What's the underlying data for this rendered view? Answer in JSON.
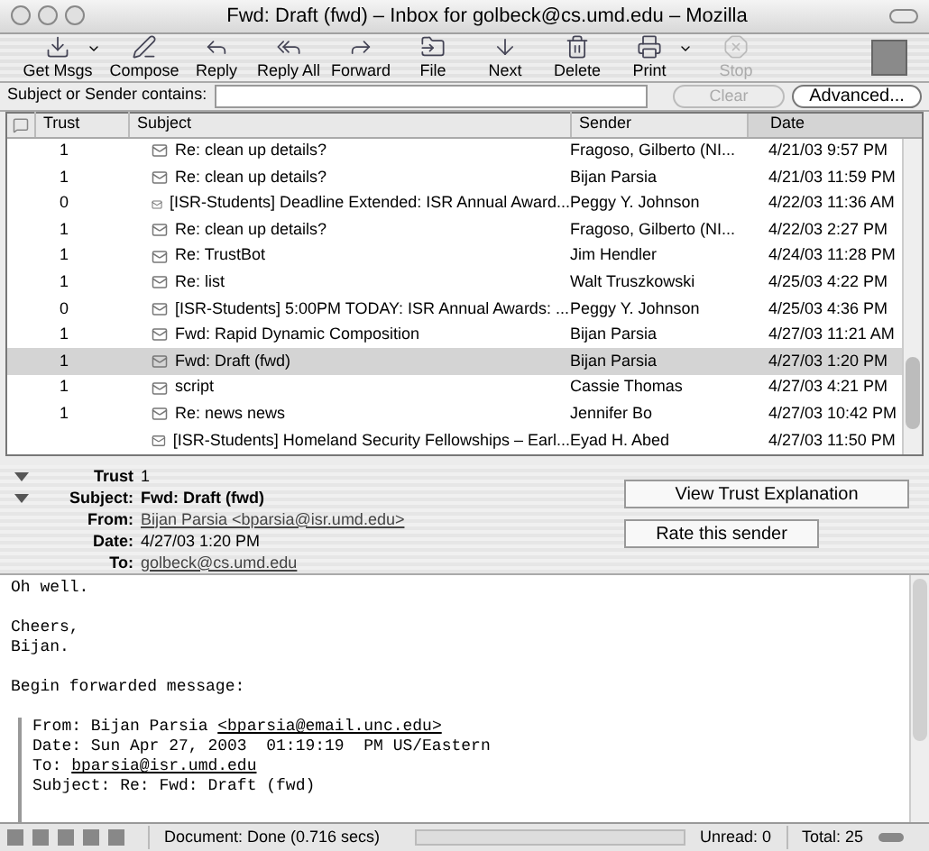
{
  "window": {
    "title": "Fwd: Draft (fwd) – Inbox for golbeck@cs.umd.edu – Mozilla"
  },
  "toolbar": [
    {
      "label": "Get Msgs",
      "kind": "getmsgs",
      "dropdown": true,
      "disabled": false
    },
    {
      "label": "Compose",
      "kind": "compose",
      "dropdown": false,
      "disabled": false
    },
    {
      "label": "Reply",
      "kind": "reply",
      "dropdown": false,
      "disabled": false
    },
    {
      "label": "Reply All",
      "kind": "replyall",
      "dropdown": false,
      "disabled": false
    },
    {
      "label": "Forward",
      "kind": "forward",
      "dropdown": false,
      "disabled": false
    },
    {
      "label": "File",
      "kind": "file",
      "dropdown": false,
      "disabled": false
    },
    {
      "label": "Next",
      "kind": "next",
      "dropdown": false,
      "disabled": false
    },
    {
      "label": "Delete",
      "kind": "delete",
      "dropdown": false,
      "disabled": false
    },
    {
      "label": "Print",
      "kind": "print",
      "dropdown": true,
      "disabled": false
    },
    {
      "label": "Stop",
      "kind": "stop",
      "dropdown": false,
      "disabled": true
    }
  ],
  "search": {
    "label": "Subject or Sender contains:",
    "clear": "Clear",
    "advanced": "Advanced..."
  },
  "table": {
    "columns": [
      "Trust",
      "Subject",
      "Sender",
      "Date"
    ],
    "rows": [
      {
        "trust": "1",
        "subject": "Re: clean up details?",
        "sender": "Fragoso, Gilberto (NI...",
        "date": "4/21/03 9:57 PM",
        "selected": false
      },
      {
        "trust": "1",
        "subject": "Re: clean up details?",
        "sender": "Bijan Parsia",
        "date": "4/21/03 11:59 PM",
        "selected": false
      },
      {
        "trust": "0",
        "subject": "[ISR-Students] Deadline Extended: ISR Annual Award...",
        "sender": "Peggy Y. Johnson",
        "date": "4/22/03 11:36 AM",
        "selected": false
      },
      {
        "trust": "1",
        "subject": "Re: clean up details?",
        "sender": "Fragoso, Gilberto (NI...",
        "date": "4/22/03 2:27 PM",
        "selected": false
      },
      {
        "trust": "1",
        "subject": "Re: TrustBot",
        "sender": "Jim Hendler",
        "date": "4/24/03 11:28 PM",
        "selected": false
      },
      {
        "trust": "1",
        "subject": "Re: list",
        "sender": "Walt Truszkowski",
        "date": "4/25/03 4:22 PM",
        "selected": false
      },
      {
        "trust": "0",
        "subject": "[ISR-Students] 5:00PM TODAY: ISR Annual Awards: ...",
        "sender": "Peggy Y. Johnson",
        "date": "4/25/03 4:36 PM",
        "selected": false
      },
      {
        "trust": "1",
        "subject": "Fwd: Rapid Dynamic Composition",
        "sender": "Bijan Parsia",
        "date": "4/27/03 11:21 AM",
        "selected": false
      },
      {
        "trust": "1",
        "subject": "Fwd: Draft (fwd)",
        "sender": "Bijan Parsia",
        "date": "4/27/03 1:20 PM",
        "selected": true
      },
      {
        "trust": "1",
        "subject": "script",
        "sender": "Cassie Thomas",
        "date": "4/27/03 4:21 PM",
        "selected": false
      },
      {
        "trust": "1",
        "subject": "Re: news news",
        "sender": "Jennifer Bo",
        "date": "4/27/03 10:42 PM",
        "selected": false
      },
      {
        "subject": "[ISR-Students] Homeland Security Fellowships – Earl...",
        "sender": "Eyad H. Abed",
        "date": "4/27/03 11:50 PM",
        "selected": false
      }
    ]
  },
  "headers": [
    {
      "label": "Trust",
      "value": "1",
      "expanded": true,
      "link": false,
      "bold": false
    },
    {
      "label": "Subject:",
      "value": "Fwd: Draft (fwd)",
      "expanded": true,
      "link": false,
      "bold": true
    },
    {
      "label": "From:",
      "value": "Bijan Parsia <bparsia@isr.umd.edu>",
      "link": true,
      "bold": false
    },
    {
      "label": "Date:",
      "value": "4/27/03 1:20 PM",
      "link": false,
      "bold": false
    },
    {
      "label": "To:",
      "value": "golbeck@cs.umd.edu",
      "link": true,
      "bold": false
    }
  ],
  "trust_buttons": [
    "View Trust Explanation",
    "Rate this sender"
  ],
  "body": {
    "paragraphs": [
      {
        "lines": [
          "Oh well."
        ]
      },
      {
        "lines": [
          "Cheers,",
          "Bijan."
        ]
      },
      {
        "lines": [
          "Begin forwarded message:"
        ]
      }
    ],
    "quoted": [
      {
        "label": "From: Bijan Parsia ",
        "link": "<bparsia@email.unc.edu>"
      },
      {
        "label": "Date: Sun Apr 27, 2003  01:19:19  PM US/Eastern"
      },
      {
        "label": "To: ",
        "link": "bparsia@isr.umd.edu"
      },
      {
        "label": "Subject: Re: Fwd: Draft (fwd)"
      }
    ]
  },
  "status_bar": {
    "text": "Document: Done (0.716 secs)",
    "unread": "Unread: 0",
    "total": "Total: 25"
  }
}
